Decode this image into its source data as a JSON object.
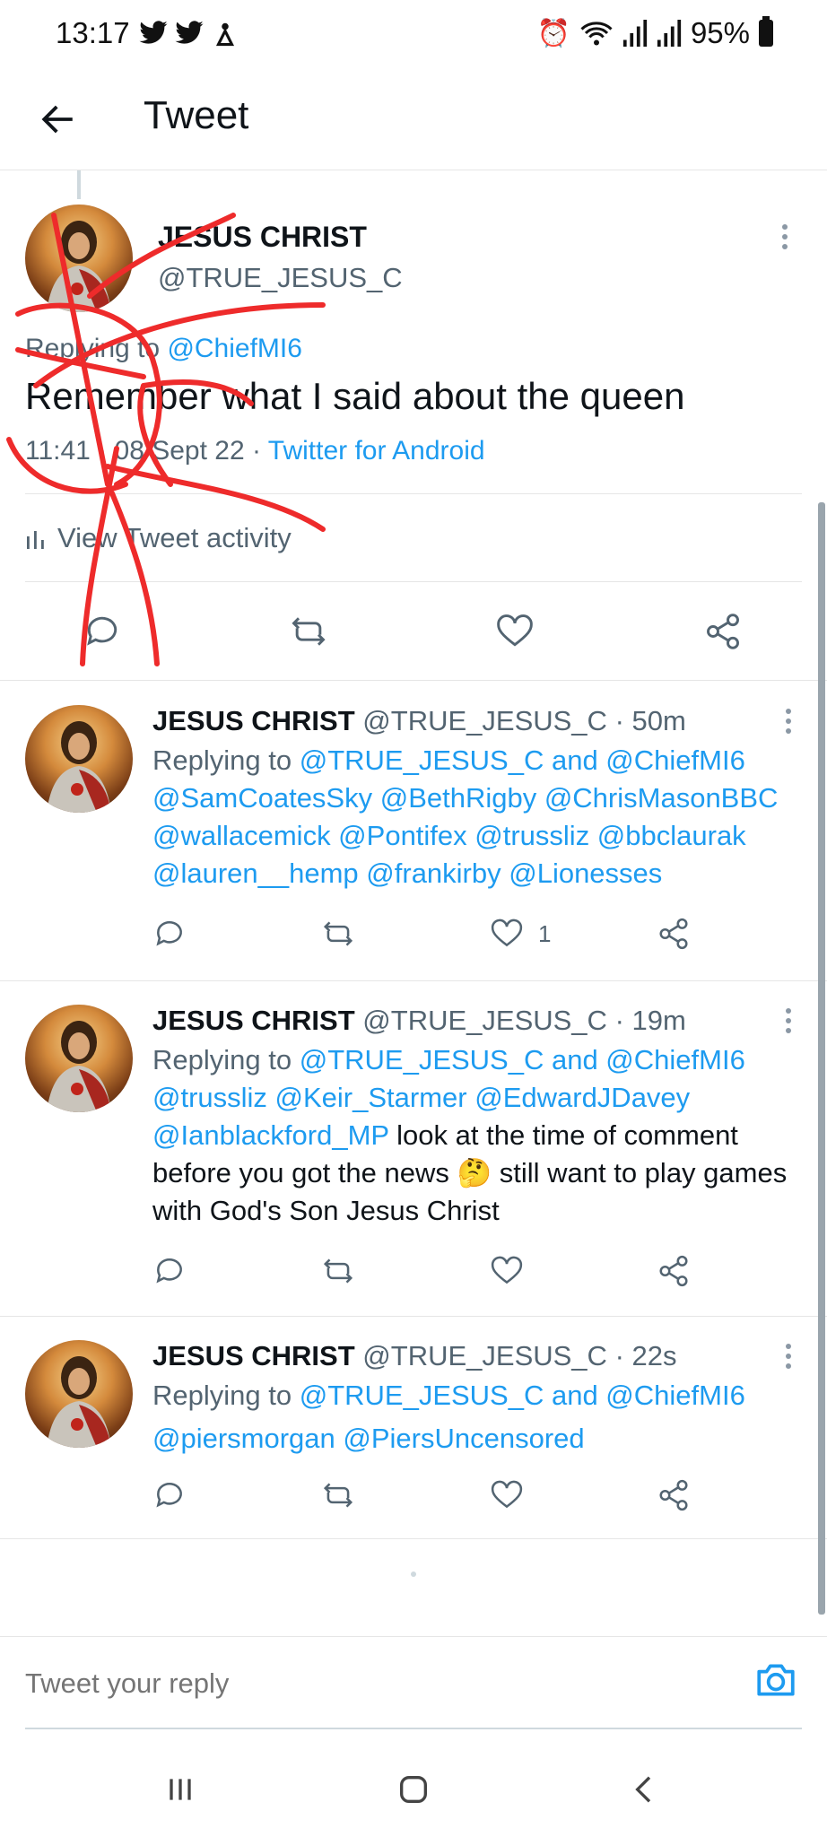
{
  "status_bar": {
    "time": "13:17",
    "battery": "95%"
  },
  "header": {
    "title": "Tweet"
  },
  "main_tweet": {
    "name": "JESUS CHRIST",
    "handle": "@TRUE_JESUS_C",
    "replying_prefix": "Replying to",
    "replying_to": "@ChiefMI6",
    "text": "Remember what I said about the queen",
    "time": "11:41",
    "date": "08 Sept 22",
    "source": "Twitter for Android",
    "activity_label": "View Tweet activity"
  },
  "replies": [
    {
      "name": "JESUS CHRIST",
      "handle": "@TRUE_JESUS_C",
      "age": "· 50m",
      "replying_prefix": "Replying to",
      "replying_main": "@TRUE_JESUS_C and @ChiefMI6",
      "mentions_1": "@SamCoatesSky @BethRigby @ChrisMasonBBC",
      "mentions_2": "@wallacemick @Pontifex @trussliz @bbclaurak",
      "mentions_3": "@lauren__hemp @frankirby @Lionesses",
      "like_count": "1"
    },
    {
      "name": "JESUS CHRIST",
      "handle": "@TRUE_JESUS_C",
      "age": "· 19m",
      "replying_prefix": "Replying to",
      "replying_main": "@TRUE_JESUS_C and @ChiefMI6",
      "mentions_1": "@trussliz @Keir_Starmer @EdwardJDavey",
      "mentions_2": "@Ianblackford_MP",
      "text_1": " look at the time of comment",
      "text_2a": "before you got the news ",
      "emoji": "🤔",
      "text_2b": " still want to play games",
      "text_3": "with God's Son Jesus Christ"
    },
    {
      "name": "JESUS CHRIST",
      "handle": "@TRUE_JESUS_C",
      "age": "· 22s",
      "replying_prefix": "Replying to",
      "replying_main": "@TRUE_JESUS_C and @ChiefMI6",
      "mentions_1": "@piersmorgan @PiersUncensored"
    }
  ],
  "reply_bar": {
    "placeholder": "Tweet your reply"
  },
  "colors": {
    "link": "#1d9bf0",
    "annotation": "#ee2b2b"
  }
}
